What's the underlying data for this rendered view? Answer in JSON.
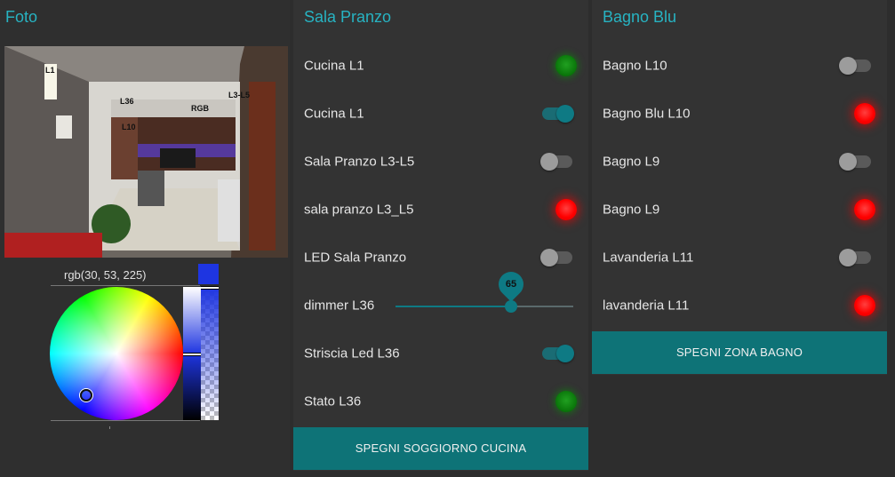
{
  "foto": {
    "title": "Foto",
    "photo_labels": [
      "L1",
      "L36",
      "RGB",
      "L3-L5",
      "L10"
    ]
  },
  "color_picker": {
    "rgb_text": "rgb(30, 53, 225)",
    "color": "#1e35e1"
  },
  "sala_pranzo": {
    "title": "Sala Pranzo",
    "rows": [
      {
        "label": "Cucina L1",
        "kind": "led",
        "state": "green"
      },
      {
        "label": "Cucina L1",
        "kind": "toggle",
        "state": "on"
      },
      {
        "label": "Sala Pranzo L3-L5",
        "kind": "toggle",
        "state": "off"
      },
      {
        "label": "sala pranzo L3_L5",
        "kind": "led",
        "state": "red"
      },
      {
        "label": "LED Sala Pranzo",
        "kind": "toggle",
        "state": "off"
      },
      {
        "label": "dimmer L36",
        "kind": "slider",
        "value": "65"
      },
      {
        "label": "Striscia Led L36",
        "kind": "toggle",
        "state": "on"
      },
      {
        "label": "Stato L36",
        "kind": "led",
        "state": "green"
      }
    ],
    "button_label": "SPEGNI SOGGIORNO CUCINA"
  },
  "bagno_blu": {
    "title": "Bagno Blu",
    "rows": [
      {
        "label": "Bagno L10",
        "kind": "toggle",
        "state": "off"
      },
      {
        "label": "Bagno Blu L10",
        "kind": "led",
        "state": "red"
      },
      {
        "label": "Bagno L9",
        "kind": "toggle",
        "state": "off"
      },
      {
        "label": "Bagno L9",
        "kind": "led",
        "state": "red"
      },
      {
        "label": "Lavanderia L11",
        "kind": "toggle",
        "state": "off"
      },
      {
        "label": "lavanderia L11",
        "kind": "led",
        "state": "red"
      }
    ],
    "button_label": "SPEGNI ZONA BAGNO"
  },
  "colors": {
    "accent": "#27b3c2",
    "button": "#0e7377",
    "led_red": "#ff0000",
    "led_green": "#0c7a0c"
  }
}
